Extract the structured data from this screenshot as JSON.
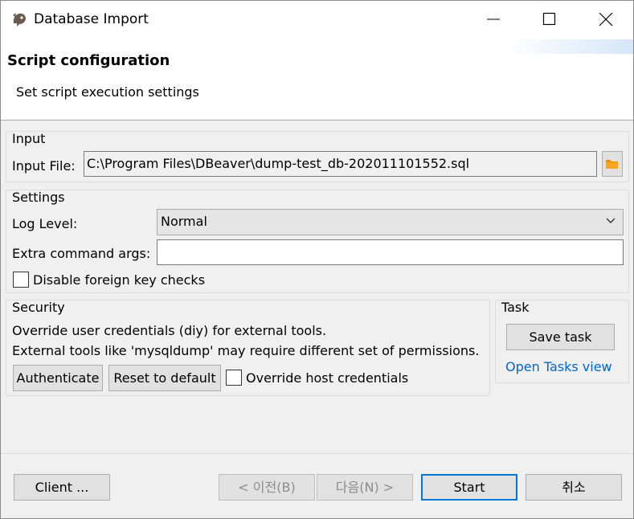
{
  "window": {
    "title": "Database Import"
  },
  "header": {
    "title": "Script configuration",
    "description": "Set script execution settings"
  },
  "input": {
    "group_title": "Input",
    "file_label": "Input File:",
    "file_value": "C:\\Program Files\\DBeaver\\dump-test_db-202011101552.sql"
  },
  "settings": {
    "group_title": "Settings",
    "log_level_label": "Log Level:",
    "log_level_value": "Normal",
    "extra_args_label": "Extra command args:",
    "extra_args_value": "",
    "disable_fk_label": "Disable foreign key checks",
    "disable_fk_checked": false
  },
  "security": {
    "group_title": "Security",
    "line1": "Override user credentials (diy) for external tools.",
    "line2": "External tools like 'mysqldump' may require different set of permissions.",
    "authenticate_label": "Authenticate",
    "reset_label": "Reset to default",
    "override_host_label": "Override host credentials",
    "override_host_checked": false
  },
  "task": {
    "group_title": "Task",
    "save_label": "Save task",
    "open_tasks_label": "Open Tasks view"
  },
  "footer": {
    "client_label": "Client ...",
    "prev_label": "< 이전(B)",
    "next_label": "다음(N) >",
    "start_label": "Start",
    "cancel_label": "취소"
  },
  "colors": {
    "link": "#0066cc",
    "primary_border": "#0078d7",
    "folder_icon": "#f08c00"
  },
  "icons": {
    "app": "dbeaver-beaver-icon",
    "folder": "folder-icon",
    "dropdown": "chevron-down-icon"
  }
}
